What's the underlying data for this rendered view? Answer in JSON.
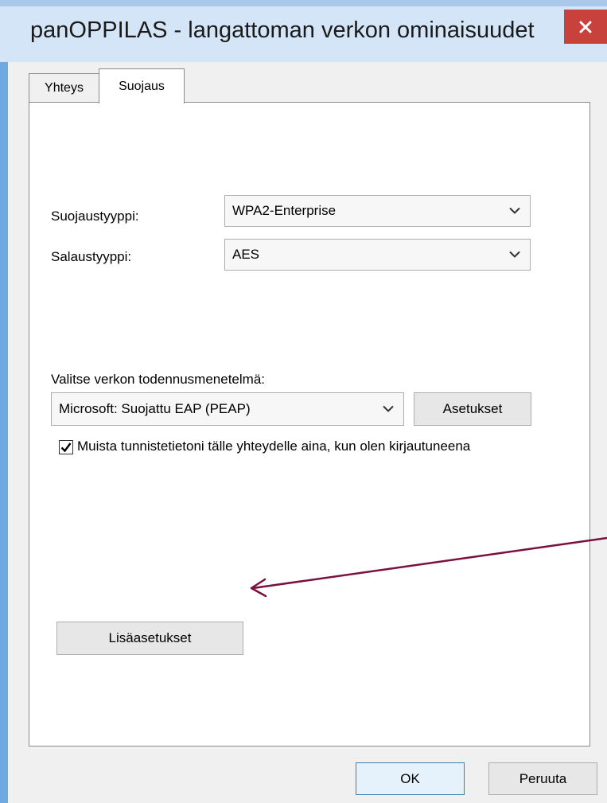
{
  "window": {
    "title": "panOPPILAS - langattoman verkon ominaisuudet",
    "close_icon": "close-icon"
  },
  "tabs": [
    {
      "label": "Yhteys",
      "active": false
    },
    {
      "label": "Suojaus",
      "active": true
    }
  ],
  "security": {
    "type_label": "Suojaustyyppi:",
    "type_value": "WPA2-Enterprise",
    "encryption_label": "Salaustyyppi:",
    "encryption_value": "AES"
  },
  "auth": {
    "method_label": "Valitse verkon todennusmenetelmä:",
    "method_value": "Microsoft: Suojattu EAP (PEAP)",
    "settings_button": "Asetukset",
    "remember_checked": true,
    "remember_text": "Muista tunnistetietoni tälle yhteydelle aina, kun olen kirjautuneena"
  },
  "advanced_button": "Lisäasetukset",
  "footer": {
    "ok_label": "OK",
    "cancel_label": "Peruuta"
  },
  "colors": {
    "title_bar": "#d4e5f7",
    "close_button": "#c8413d",
    "annotation_arrow": "#7a1040"
  }
}
